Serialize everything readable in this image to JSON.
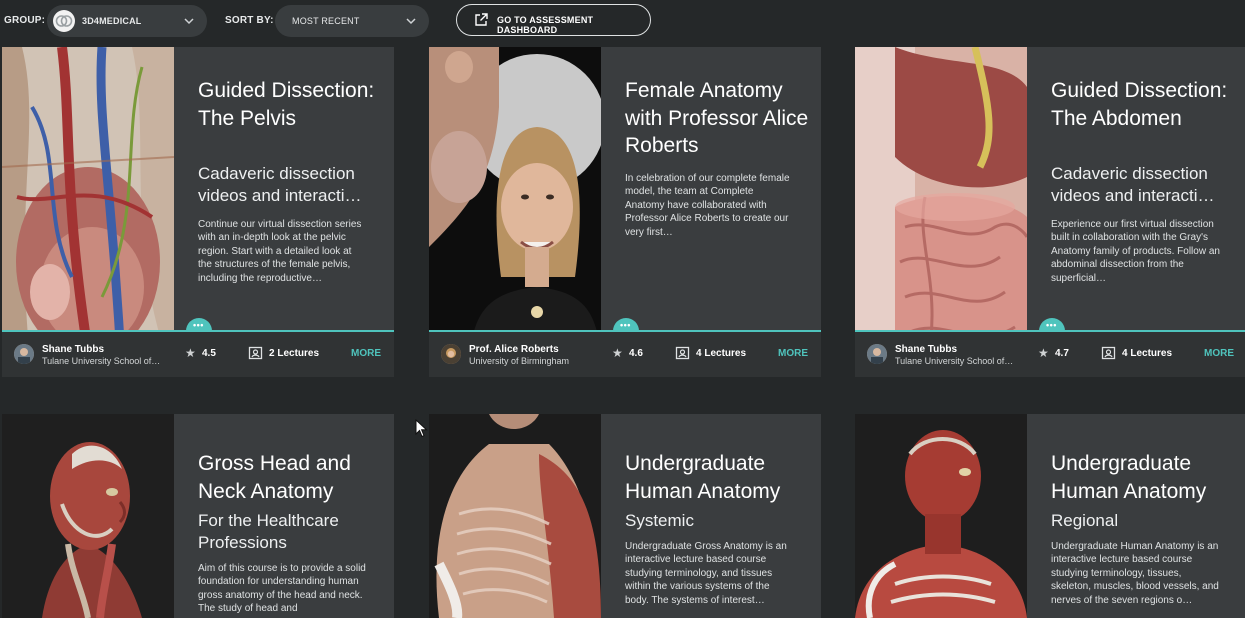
{
  "toolbar": {
    "group_label": "GROUP:",
    "group_value": "3D4MEDICAL",
    "sort_label": "SORT BY:",
    "sort_value": "MOST RECENT",
    "assessment_button": "GO TO ASSESSMENT DASHBOARD"
  },
  "colors": {
    "accent": "#4fc4bd",
    "background": "#252829",
    "card": "#3a3d3f",
    "footer": "#303334"
  },
  "courses": [
    {
      "title": "Guided Dissection: The Pelvis",
      "subtitle": "Cadaveric dissection videos and interacti…",
      "description": "Continue our virtual dissection series with an in-depth look at the pelvic region. Start with a detailed look at the structures of the female pelvis, including the reproductive…",
      "author": "Shane Tubbs",
      "school": "Tulane University School of…",
      "rating": "4.5",
      "lectures": "2 Lectures",
      "more": "MORE"
    },
    {
      "title": "Female Anatomy with Professor Alice Roberts",
      "subtitle": "",
      "description": "In celebration of our complete female model, the team at Complete Anatomy have collaborated with Professor Alice Roberts to create our very first…",
      "author": "Prof. Alice Roberts",
      "school": "University of Birmingham",
      "rating": "4.6",
      "lectures": "4 Lectures",
      "more": "MORE"
    },
    {
      "title": "Guided Dissection: The Abdomen",
      "subtitle": "Cadaveric dissection videos and interacti…",
      "description": "Experience our first virtual dissection built in collaboration with the Gray's Anatomy family of products. Follow an abdominal dissection from the superficial…",
      "author": "Shane Tubbs",
      "school": "Tulane University School of…",
      "rating": "4.7",
      "lectures": "4 Lectures",
      "more": "MORE"
    },
    {
      "title": "Gross Head and Neck Anatomy",
      "subtitle": "For the Healthcare Professions",
      "description": "Aim of this course is to provide a solid foundation for understanding human gross anatomy of the head and neck. The study of head and"
    },
    {
      "title": "Undergraduate Human Anatomy",
      "subtitle": "Systemic",
      "description": "Undergraduate Gross Anatomy is an interactive lecture based course studying terminology, and tissues within the various systems of the body. The systems of interest…"
    },
    {
      "title": "Undergraduate Human Anatomy",
      "subtitle": "Regional",
      "description": "Undergraduate Human Anatomy is an interactive lecture based course studying terminology, tissues, skeleton, muscles, blood vessels, and nerves of the seven regions o…"
    }
  ]
}
